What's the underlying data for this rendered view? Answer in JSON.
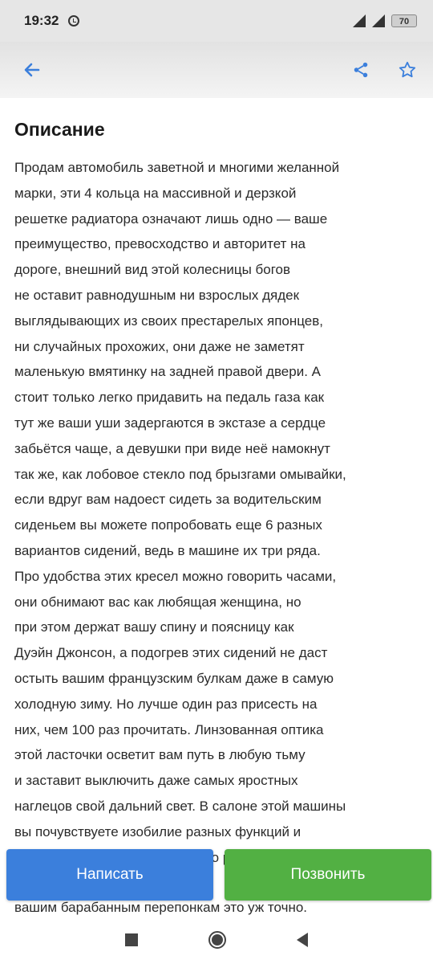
{
  "status_bar": {
    "time": "19:32",
    "battery": "70"
  },
  "app_bar": {
    "back_icon": "arrow-left-icon",
    "share_icon": "share-icon",
    "favorite_icon": "star-outline-icon"
  },
  "content": {
    "title": "Описание",
    "text": "Продам автомобиль заветной и многими желанной\nмарки, эти 4 кольца на массивной и дерзкой\nрешетке радиатора означают лишь одно — ваше\nпреимущество, превосходство и авторитет на\nдороге, внешний вид этой колесницы богов\nне оставит равнодушным ни взрослых дядек\nвыглядывающих из своих престарелых японцев,\nни случайных прохожих, они даже не заметят\nмаленькую вмятинку на задней правой двери. А\nстоит только легко придавить на педаль газа как\nтут же ваши уши задергаются в экстазе а сердце\nзабьётся чаще, а девушки при виде неё намокнут\nтак же, как лобовое стекло под брызгами омывайки,\nесли вдруг вам надоест сидеть за водительским\nсиденьем вы можете попробовать еще 6 разных\nвариантов сидений, ведь в машине их три ряда.\nПро удобства этих кресел можно говорить часами,\nони обнимают вас как любящая женщина, но\nпри этом держат вашу спину и поясницу как\nДуэйн Джонсон, а подогрев этих сидений не даст\nостыть вашим французским булкам даже в самую\nхолодную зиму. Но лучше один раз присесть на\nних, чем 100 раз прочитать. Линзованная оптика\nэтой ласточки осветит вам путь в любую тьму\nи заставит выключить даже самых яростных\nнаглецов свой дальний свет. В салоне этой машины\nвы почувствуете изобилие разных функций и\nприборов, которые будут только рады помогать вам",
    "below_text": "вашим барабанным перепонкам это уж точно."
  },
  "actions": {
    "write_label": "Написать",
    "call_label": "Позвонить"
  },
  "colors": {
    "accent": "#3b7fdc",
    "write_button": "#3b7fdc",
    "call_button": "#52b043"
  }
}
